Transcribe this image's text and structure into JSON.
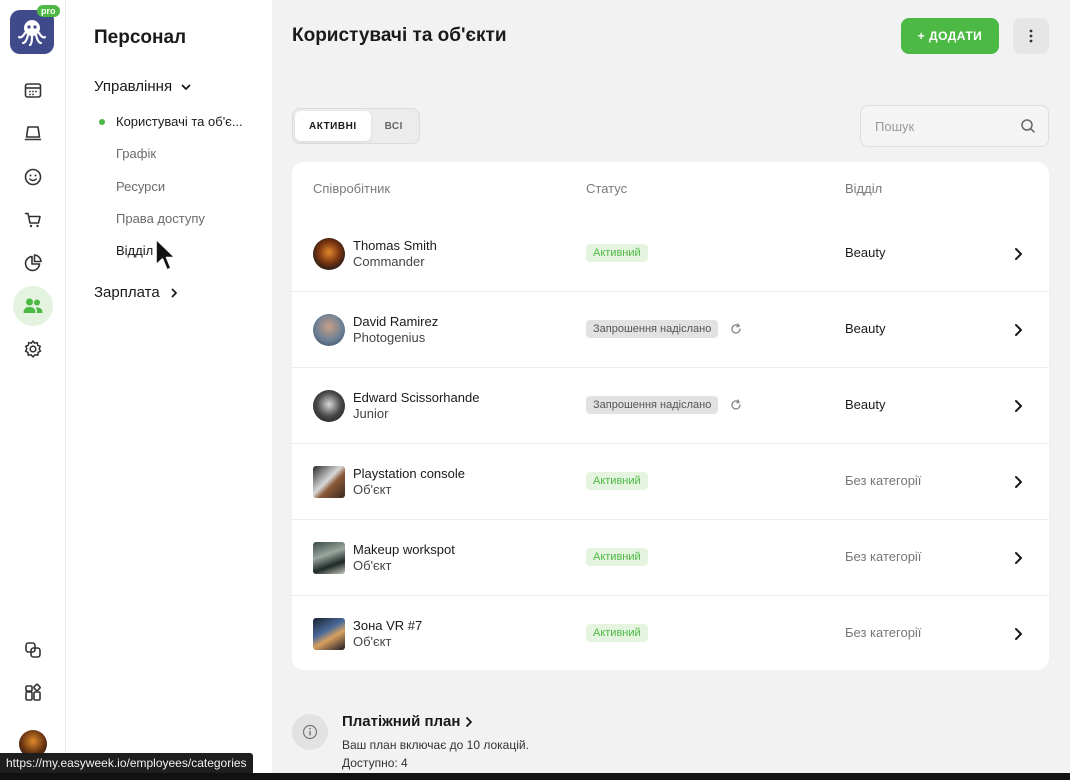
{
  "rail": {
    "pro_badge": "pro",
    "icons": [
      "octopus-logo-icon",
      "calendar-icon",
      "desk-icon",
      "smile-icon",
      "cart-icon",
      "pie-chart-icon",
      "users-icon",
      "gear-icon",
      "layers-icon",
      "widgets-icon"
    ]
  },
  "nav": {
    "title": "Персонал",
    "group_management": "Управління",
    "items": [
      "Користувачі та об'є...",
      "Графік",
      "Ресурси",
      "Права доступу",
      "Відділ"
    ],
    "group_salary": "Зарплата"
  },
  "main": {
    "title": "Користувачі та об'єкти",
    "add_button": "+ ДОДАТИ",
    "tabs": [
      "АКТИВНІ",
      "ВСІ"
    ],
    "search_placeholder": "Пошук",
    "columns": {
      "employee": "Співробітник",
      "status": "Статус",
      "department": "Відділ"
    },
    "rows": [
      {
        "name": "Thomas Smith",
        "role": "Commander",
        "status": "Активний",
        "department": "Beauty"
      },
      {
        "name": "David Ramirez",
        "role": "Photogenius",
        "status": "Запрошення надіслано",
        "department": "Beauty"
      },
      {
        "name": "Edward Scissorhande",
        "role": "Junior",
        "status": "Запрошення надіслано",
        "department": "Beauty"
      },
      {
        "name": "Playstation console",
        "role": "Об'єкт",
        "status": "Активний",
        "department": "Без категорії"
      },
      {
        "name": "Makeup workspot",
        "role": "Об'єкт",
        "status": "Активний",
        "department": "Без категорії"
      },
      {
        "name": "Зона VR #7",
        "role": "Об'єкт",
        "status": "Активний",
        "department": "Без категорії"
      }
    ],
    "plan": {
      "title": "Платіжний план",
      "text": "Ваш план включає до 10 локацій. Доступно: 4"
    }
  },
  "status_url": "https://my.easyweek.io/employees/categories",
  "colors": {
    "accent": "#4cb944",
    "logo_bg": "#3f4a8a",
    "active_badge_bg": "#e5f4df"
  }
}
